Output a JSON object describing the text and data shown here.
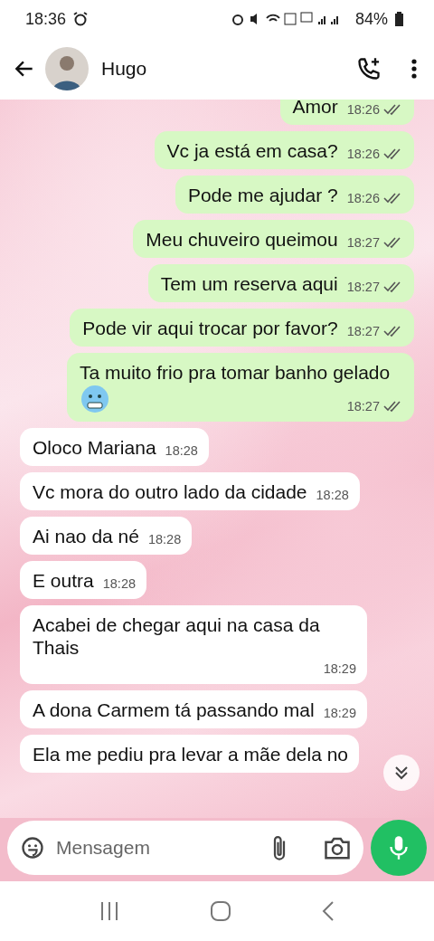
{
  "status_bar": {
    "time": "18:36",
    "battery": "84%"
  },
  "header": {
    "contact": "Hugo"
  },
  "messages": [
    {
      "kind": "sent",
      "text": "Amor",
      "time": "18:26",
      "read": false
    },
    {
      "kind": "sent",
      "text": "Vc ja está em casa?",
      "time": "18:26",
      "read": false
    },
    {
      "kind": "sent",
      "text": "Pode me ajudar ?",
      "time": "18:26",
      "read": false
    },
    {
      "kind": "sent",
      "text": "Meu chuveiro queimou",
      "time": "18:27",
      "read": false
    },
    {
      "kind": "sent",
      "text": "Tem um reserva aqui",
      "time": "18:27",
      "read": false
    },
    {
      "kind": "sent",
      "text": "Pode vir aqui trocar por favor?",
      "time": "18:27",
      "read": false
    },
    {
      "kind": "sent",
      "text": "Ta muito frio pra tomar banho gelado",
      "time": "18:27",
      "read": false,
      "emoji": true
    },
    {
      "kind": "received",
      "text": "Oloco Mariana",
      "time": "18:28"
    },
    {
      "kind": "received",
      "text": "Vc mora do outro lado da cidade",
      "time": "18:28"
    },
    {
      "kind": "received",
      "text": "Ai nao da né",
      "time": "18:28"
    },
    {
      "kind": "received",
      "text": "E outra",
      "time": "18:28"
    },
    {
      "kind": "received",
      "text": "Acabei de chegar aqui na casa da Thais",
      "time": "18:29"
    },
    {
      "kind": "received",
      "text": "A dona Carmem tá passando mal",
      "time": "18:29"
    },
    {
      "kind": "received",
      "text": "Ela me pediu pra levar a mãe dela no"
    }
  ],
  "composer": {
    "placeholder": "Mensagem"
  }
}
